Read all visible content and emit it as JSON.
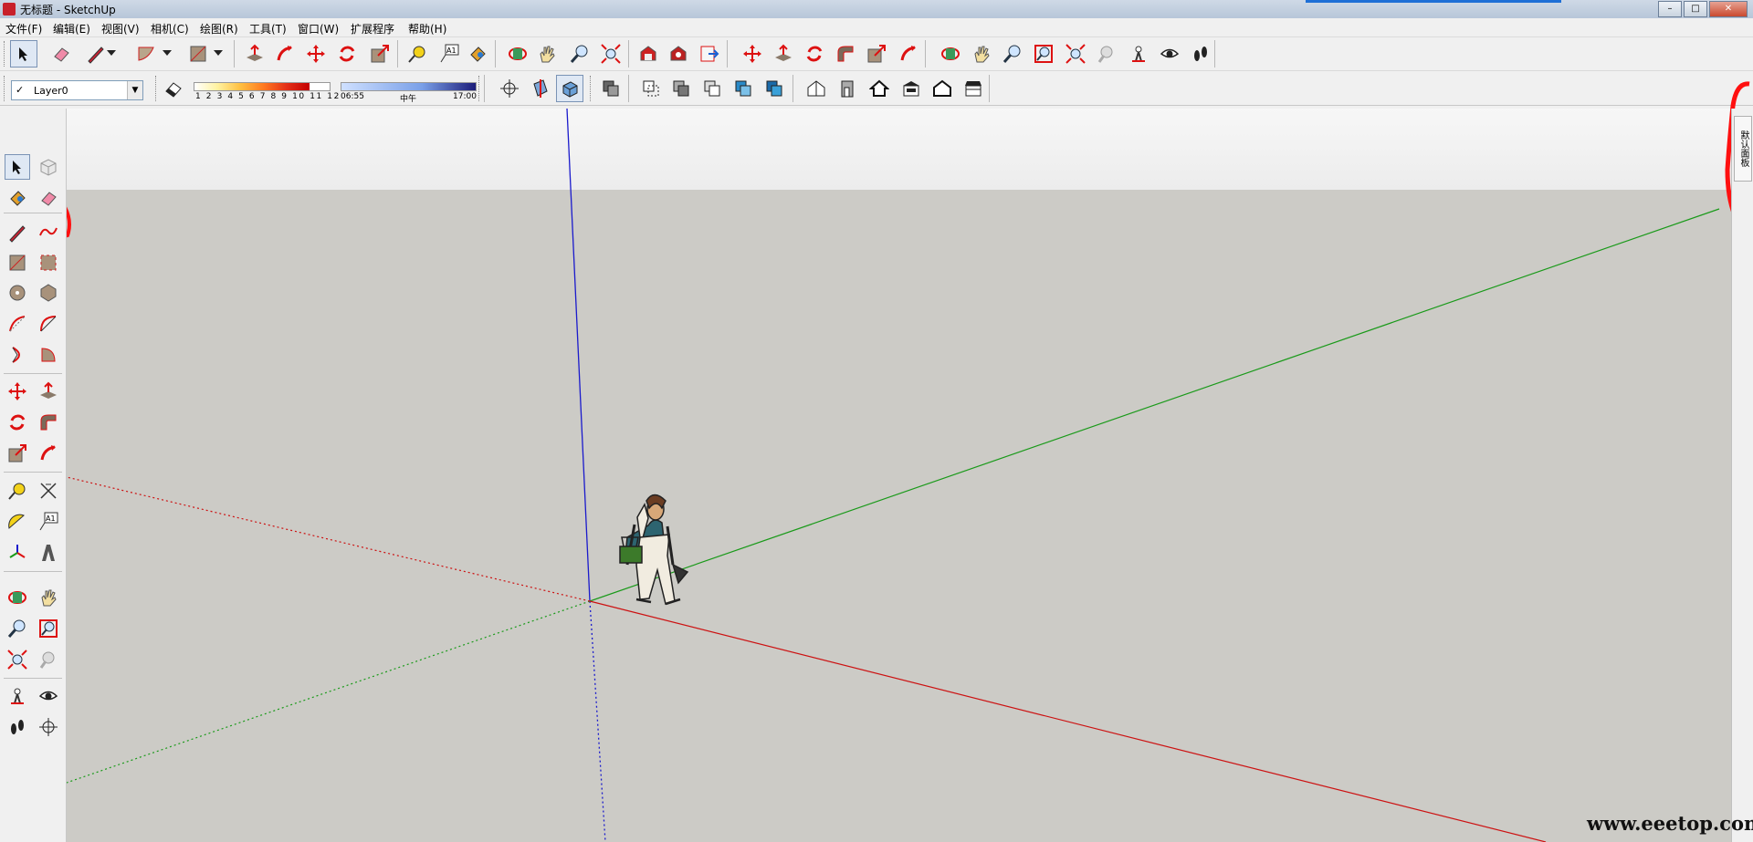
{
  "window": {
    "title": "无标题 - SketchUp",
    "controls": [
      "–",
      "□",
      "✕"
    ]
  },
  "menu": [
    "文件(F)",
    "编辑(E)",
    "视图(V)",
    "相机(C)",
    "绘图(R)",
    "工具(T)",
    "窗口(W)",
    "扩展程序",
    "帮助(H)"
  ],
  "layer": {
    "check": "✓",
    "name": "Layer0",
    "arrow": "▼"
  },
  "shadow": {
    "ticks": "1 2 3 4 5 6 7 8 9 10 11 12",
    "time_start": "06:55",
    "time_mid": "中午",
    "time_end": "17:00"
  },
  "tray_tab": "默认面板",
  "watermark": "www.eeetop.com",
  "colors": {
    "red_axis": "#d11",
    "green_axis": "#1a9a1a",
    "blue_axis": "#1a1acc",
    "sky": "#f4f4f4",
    "ground": "#cccbc6",
    "annotation": "#ff1010"
  },
  "icons": {
    "toolbar1": [
      "select",
      "eraser",
      "pencil",
      "dropdown",
      "arc",
      "dropdown",
      "rectangle",
      "dropdown",
      "push-pull",
      "follow-me",
      "move",
      "rotate",
      "scale",
      "tape-measure",
      "text",
      "paint-bucket",
      "orbit",
      "pan",
      "zoom",
      "zoom-extents",
      "warehouse",
      "extension-warehouse",
      "send-to-layout",
      "move",
      "push-pull",
      "rotate",
      "offset",
      "scale",
      "follow-me",
      "orbit",
      "pan",
      "zoom",
      "zoom-window",
      "zoom-extents",
      "previous-view",
      "position-camera",
      "look-around",
      "walk"
    ],
    "toolbar2": [
      "eraser",
      "axes",
      "section-plane",
      "section-display",
      "styles-xray",
      "styles-backedges",
      "styles-wireframe",
      "styles-hidden",
      "styles-shaded",
      "styles-textured",
      "styles-monochrome",
      "iso-view",
      "front-view",
      "home-view",
      "back-view",
      "left-view",
      "right-view"
    ],
    "left": [
      "select",
      "make-component",
      "paint-bucket",
      "eraser",
      "pencil",
      "freehand",
      "rectangle",
      "rotated-rectangle",
      "circle",
      "polygon",
      "arc",
      "two-point-arc",
      "three-point-arc",
      "pie",
      "move",
      "push-pull",
      "rotate",
      "follow-me",
      "scale",
      "offset",
      "tape-measure",
      "dimension",
      "protractor",
      "text",
      "axes",
      "3d-text",
      "orbit",
      "pan",
      "zoom",
      "zoom-window",
      "zoom-extents",
      "previous-view",
      "position-camera",
      "look-around",
      "walk",
      "section-plane"
    ]
  }
}
